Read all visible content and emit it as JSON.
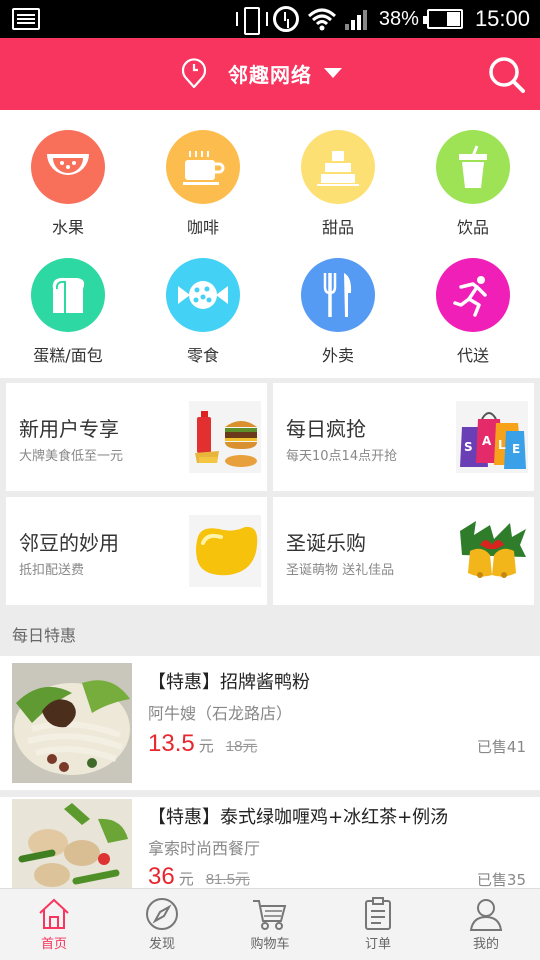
{
  "status_bar": {
    "battery_percent": "38%",
    "time": "15:00"
  },
  "header": {
    "location": "邻趣网络"
  },
  "categories": [
    {
      "label": "水果",
      "icon": "watermelon-icon",
      "color": "#f8705a"
    },
    {
      "label": "咖啡",
      "icon": "coffee-cup-icon",
      "color": "#fdbd4e"
    },
    {
      "label": "甜品",
      "icon": "cake-icon",
      "color": "#fde074"
    },
    {
      "label": "饮品",
      "icon": "drink-cup-icon",
      "color": "#9ee355"
    },
    {
      "label": "蛋糕/面包",
      "icon": "bread-icon",
      "color": "#2ed8a2"
    },
    {
      "label": "零食",
      "icon": "candy-icon",
      "color": "#43d1f5"
    },
    {
      "label": "外卖",
      "icon": "fork-knife-icon",
      "color": "#569bf3"
    },
    {
      "label": "代送",
      "icon": "runner-icon",
      "color": "#f01fb8"
    }
  ],
  "promos": [
    {
      "title": "新用户专享",
      "subtitle": "大牌美食低至一元",
      "icon": "burger-meal-icon"
    },
    {
      "title": "每日疯抢",
      "subtitle": "每天10点14点开抢",
      "icon": "shopping-bags-icon"
    },
    {
      "title": "邻豆的妙用",
      "subtitle": "抵扣配送费",
      "icon": "gold-bean-icon"
    },
    {
      "title": "圣诞乐购",
      "subtitle": "圣诞萌物 送礼佳品",
      "icon": "christmas-bells-icon"
    }
  ],
  "daily_deals": {
    "label": "每日特惠",
    "items": [
      {
        "name": "【特惠】招牌酱鸭粉",
        "shop": "阿牛嫂（石龙路店）",
        "price": "13.5",
        "unit": "元",
        "old_price": "18元",
        "sold": "已售41"
      },
      {
        "name": "【特惠】泰式绿咖喱鸡+冰红茶+例汤",
        "shop": "拿索时尚西餐厅",
        "price": "36",
        "unit": "元",
        "old_price": "81.5元",
        "sold": "已售35"
      }
    ]
  },
  "tabbar": [
    {
      "label": "首页",
      "icon": "home-icon",
      "active": true
    },
    {
      "label": "发现",
      "icon": "compass-icon",
      "active": false
    },
    {
      "label": "购物车",
      "icon": "cart-icon",
      "active": false
    },
    {
      "label": "订单",
      "icon": "clipboard-icon",
      "active": false
    },
    {
      "label": "我的",
      "icon": "user-icon",
      "active": false
    }
  ],
  "colors": {
    "brand": "#f7355e",
    "price": "#e8262e"
  }
}
